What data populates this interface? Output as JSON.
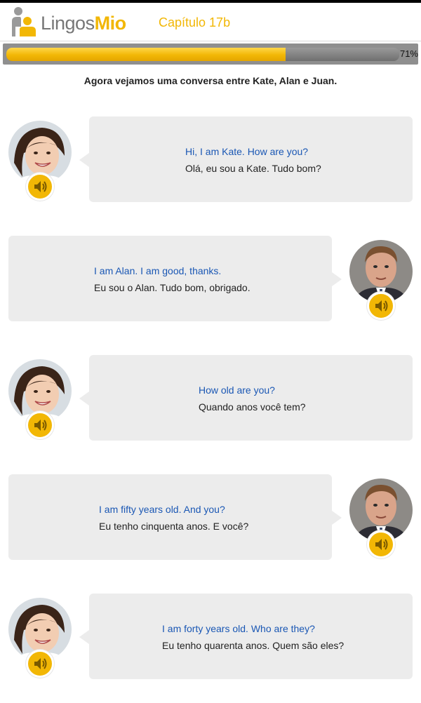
{
  "header": {
    "logo_text_1": "Lingos",
    "logo_text_2": "Mio",
    "chapter": "Capítulo  17b"
  },
  "progress": {
    "fraction": 0.71,
    "label": "71%"
  },
  "intro": "Agora vejamos uma conversa entre Kate, Alan e Juan.",
  "messages": [
    {
      "speaker": "female",
      "en": "Hi, I am Kate. How are you?",
      "pt": "Olá, eu sou a Kate. Tudo bom?"
    },
    {
      "speaker": "male",
      "en": "I am Alan. I am good, thanks.",
      "pt": "Eu sou o Alan. Tudo bom, obrigado."
    },
    {
      "speaker": "female",
      "en": "How old are you?",
      "pt": "Quando anos você tem?"
    },
    {
      "speaker": "male",
      "en": "I am fifty years old. And you?",
      "pt": "Eu tenho cinquenta anos. E você?"
    },
    {
      "speaker": "female",
      "en": "I am forty years old. Who are they?",
      "pt": "Eu tenho quarenta anos. Quem são eles?"
    }
  ],
  "colors": {
    "accent": "#f2b705",
    "english_text": "#1a57b4",
    "bubble": "#ececec"
  },
  "icons": {
    "speaker": "speaker-icon",
    "logo": "person-logo-icon"
  }
}
